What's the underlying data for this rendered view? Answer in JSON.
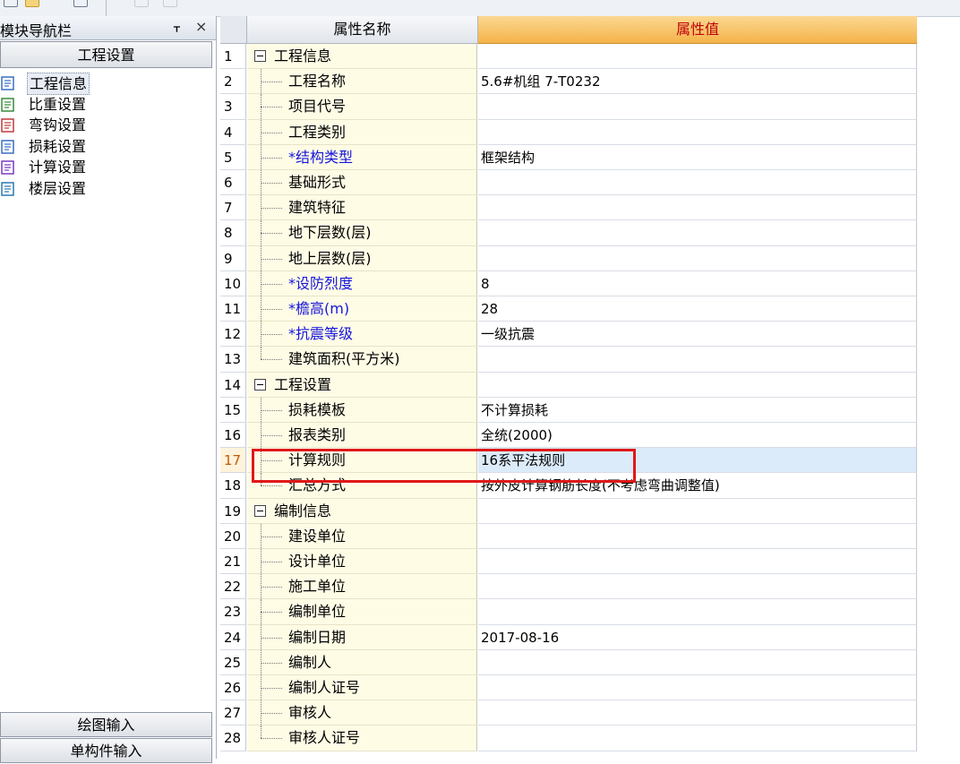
{
  "nav": {
    "title": "模块导航栏",
    "top_button": "工程设置",
    "items": [
      {
        "label": "工程信息",
        "icon": "magnifier-doc-icon",
        "selected": true
      },
      {
        "label": "比重设置",
        "icon": "scale-icon",
        "selected": false
      },
      {
        "label": "弯钩设置",
        "icon": "hook-icon",
        "selected": false
      },
      {
        "label": "损耗设置",
        "icon": "loss-chart-icon",
        "selected": false
      },
      {
        "label": "计算设置",
        "icon": "calc-settings-icon",
        "selected": false
      },
      {
        "label": "楼层设置",
        "icon": "floors-icon",
        "selected": false
      }
    ],
    "bottom_buttons": [
      "绘图输入",
      "单构件输入"
    ]
  },
  "grid": {
    "col_name_header": "属性名称",
    "col_value_header": "属性值",
    "rows": [
      {
        "n": "1",
        "group": true,
        "name": "工程信息",
        "value": ""
      },
      {
        "n": "2",
        "name": "工程名称",
        "value": "5.6#机组 7-T0232"
      },
      {
        "n": "3",
        "name": "项目代号",
        "value": ""
      },
      {
        "n": "4",
        "name": "工程类别",
        "value": ""
      },
      {
        "n": "5",
        "name": "*结构类型",
        "value": "框架结构",
        "required": true
      },
      {
        "n": "6",
        "name": "基础形式",
        "value": ""
      },
      {
        "n": "7",
        "name": "建筑特征",
        "value": ""
      },
      {
        "n": "8",
        "name": "地下层数(层)",
        "value": ""
      },
      {
        "n": "9",
        "name": "地上层数(层)",
        "value": ""
      },
      {
        "n": "10",
        "name": "*设防烈度",
        "value": "8",
        "required": true
      },
      {
        "n": "11",
        "name": "*檐高(m)",
        "value": "28",
        "required": true
      },
      {
        "n": "12",
        "name": "*抗震等级",
        "value": "一级抗震",
        "required": true
      },
      {
        "n": "13",
        "name": "建筑面积(平方米)",
        "value": "",
        "last": true
      },
      {
        "n": "14",
        "group": true,
        "name": "工程设置",
        "value": ""
      },
      {
        "n": "15",
        "name": "损耗模板",
        "value": "不计算损耗"
      },
      {
        "n": "16",
        "name": "报表类别",
        "value": "全统(2000)"
      },
      {
        "n": "17",
        "name": "计算规则",
        "value": "16系平法规则",
        "selected": true
      },
      {
        "n": "18",
        "name": "汇总方式",
        "value": "按外皮计算钢筋长度(不考虑弯曲调整值)",
        "last": true
      },
      {
        "n": "19",
        "group": true,
        "name": "编制信息",
        "value": ""
      },
      {
        "n": "20",
        "name": "建设单位",
        "value": ""
      },
      {
        "n": "21",
        "name": "设计单位",
        "value": ""
      },
      {
        "n": "22",
        "name": "施工单位",
        "value": ""
      },
      {
        "n": "23",
        "name": "编制单位",
        "value": ""
      },
      {
        "n": "24",
        "name": "编制日期",
        "value": "2017-08-16"
      },
      {
        "n": "25",
        "name": "编制人",
        "value": ""
      },
      {
        "n": "26",
        "name": "编制人证号",
        "value": ""
      },
      {
        "n": "27",
        "name": "审核人",
        "value": ""
      },
      {
        "n": "28",
        "name": "审核人证号",
        "value": "",
        "last": true
      }
    ]
  },
  "colors": {
    "required_text": "#1515dd",
    "highlight_border": "#e01818",
    "value_header": "#f4b34a"
  }
}
